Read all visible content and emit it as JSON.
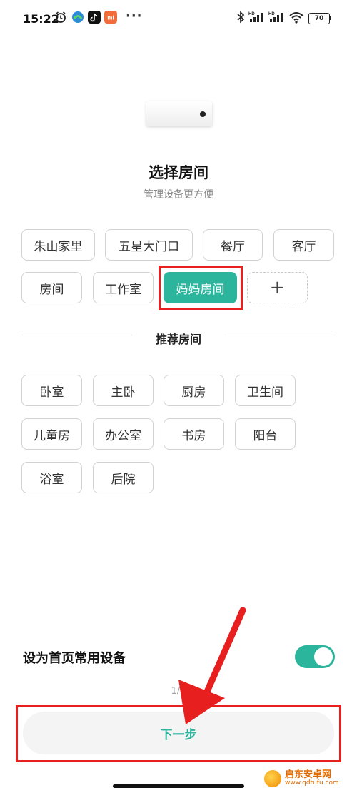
{
  "status_bar": {
    "time": "15:22",
    "more": "···",
    "battery": "70"
  },
  "header": {
    "title": "选择房间",
    "subtitle": "管理设备更方便"
  },
  "rooms": [
    {
      "label": "朱山家里",
      "selected": false
    },
    {
      "label": "五星大门口",
      "selected": false
    },
    {
      "label": "餐厅",
      "selected": false
    },
    {
      "label": "客厅",
      "selected": false
    },
    {
      "label": "房间",
      "selected": false
    },
    {
      "label": "工作室",
      "selected": false
    },
    {
      "label": "妈妈房间",
      "selected": true
    }
  ],
  "add_room": "+",
  "recommended": {
    "title": "推荐房间",
    "rooms": [
      "卧室",
      "主卧",
      "厨房",
      "卫生间",
      "儿童房",
      "办公室",
      "书房",
      "阳台",
      "浴室",
      "后院"
    ]
  },
  "toggle": {
    "label": "设为首页常用设备",
    "on": true
  },
  "page_indicator": "1/3",
  "next_button": "下一步",
  "watermark": {
    "name": "启东安卓网",
    "url": "www.qdtufu.com"
  },
  "colors": {
    "accent": "#2bb59d",
    "highlight": "#e81f1f"
  }
}
